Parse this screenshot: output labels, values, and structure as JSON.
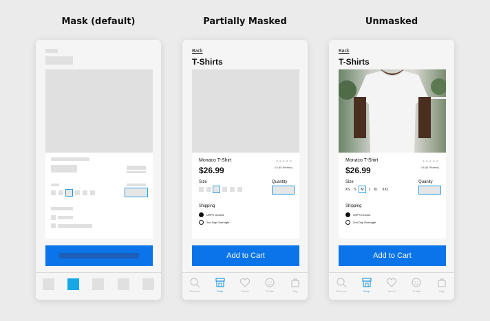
{
  "columns": {
    "mask_title": "Mask (default)",
    "partial_title": "Partially Masked",
    "unmasked_title": "Unmasked"
  },
  "partial": {
    "back": "Back",
    "title": "T-Shirts",
    "product_name": "Monaco T-Shirt",
    "price": "$26.99",
    "size_label": "Size",
    "quantity_label": "Quantity",
    "shipping_label": "Shipping",
    "shipping_options": [
      "USPS Ground",
      "2nd Day Overnight"
    ],
    "add_to_cart": "Add to Cart",
    "tabs": [
      "Discover",
      "Shop",
      "Saved",
      "Profile",
      "Bag"
    ]
  },
  "unmasked": {
    "back": "Back",
    "title": "T-Shirts",
    "product_name": "Monaco T-Shirt",
    "price": "$26.99",
    "stars": "★★★★★",
    "reviews": "4.8 (81 Reviews)",
    "size_label": "Size",
    "sizes": [
      "XS",
      "S",
      "M",
      "L",
      "XL",
      "XXL"
    ],
    "selected_size": "M",
    "quantity_label": "Quanity",
    "shipping_label": "Shipping",
    "shipping_options": [
      "USPS Ground",
      "2nd Day Overnight"
    ],
    "add_to_cart": "Add to Cart",
    "tabs": [
      "Discover",
      "Shop",
      "Saved",
      "Profile",
      "Bag"
    ]
  },
  "partial_stars": "★★★★★",
  "partial_reviews": "4.8 (81 Reviews)",
  "active_tab": "Shop",
  "colors": {
    "accent": "#0a74e8",
    "highlight": "#2a9de0",
    "mask": "#e0e0e0"
  }
}
